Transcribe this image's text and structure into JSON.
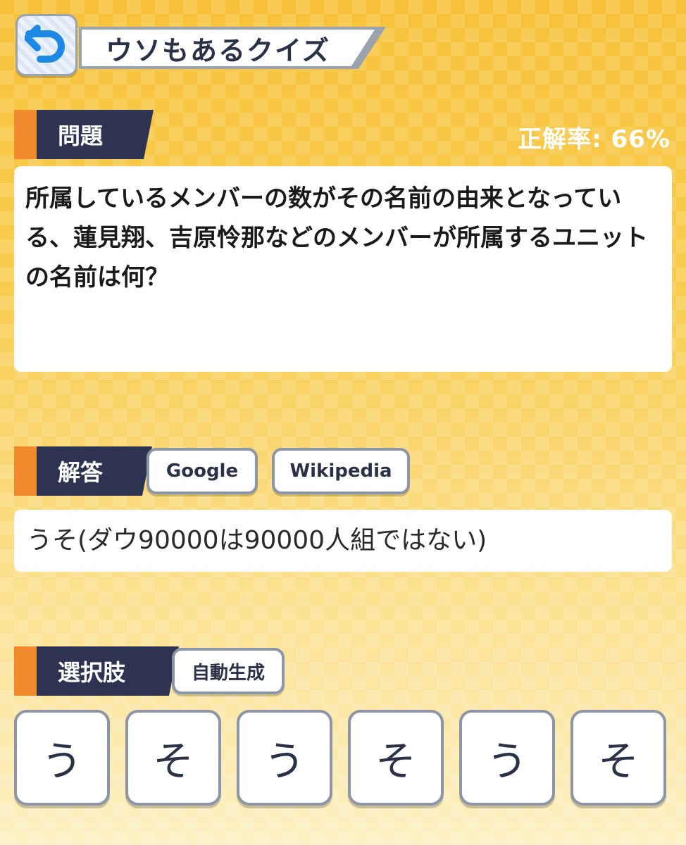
{
  "header": {
    "back_icon": "back-arrow-icon",
    "title": "ウソもあるクイズ"
  },
  "question_section": {
    "label": "問題",
    "accuracy": "正解率: 66%",
    "text": "所属しているメンバーの数がその名前の由来となっている、蓮見翔、吉原怜那などのメンバーが所属するユニットの名前は何？"
  },
  "answer_section": {
    "label": "解答",
    "google_label": "Google",
    "wikipedia_label": "Wikipedia",
    "text": "うそ(ダウ90000は90000人組ではない)"
  },
  "choices_section": {
    "label": "選択肢",
    "auto_generate_label": "自動生成",
    "options": [
      "う",
      "そ",
      "う",
      "そ",
      "う",
      "そ"
    ]
  },
  "colors": {
    "accent_orange": "#f08a2c",
    "label_navy": "#2d3350",
    "back_arrow_blue": "#1e88e5"
  }
}
